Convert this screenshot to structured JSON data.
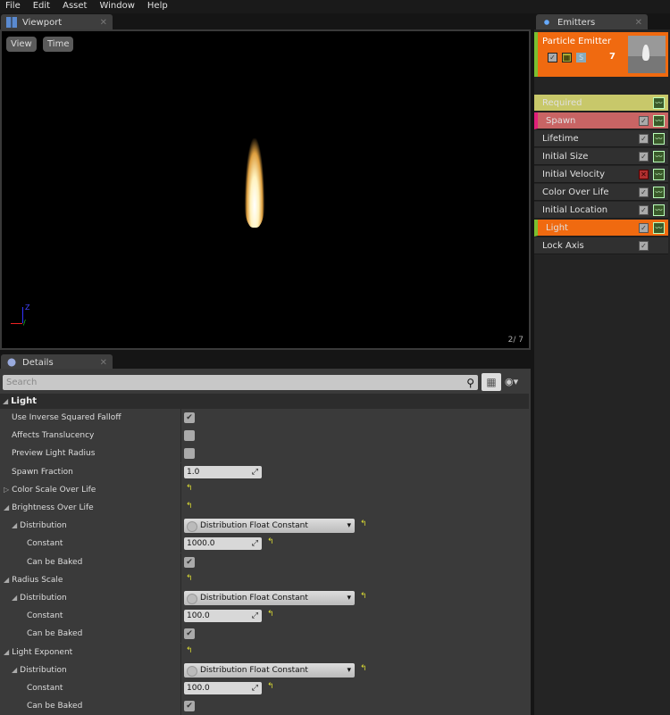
{
  "menu": [
    "File",
    "Edit",
    "Asset",
    "Window",
    "Help"
  ],
  "viewport": {
    "tab": "Viewport",
    "view_btn": "View",
    "time_btn": "Time",
    "counter": "2/  7",
    "axis_z": "Z"
  },
  "emitters": {
    "tab": "Emitters",
    "emitter_name": "Particle Emitter",
    "s_label": "S",
    "count": "7",
    "modules": [
      {
        "label": "Required",
        "bg": "#c8c86a",
        "cb": "none",
        "curve": true
      },
      {
        "label": "Spawn",
        "bg": "#c86464",
        "cb": "check",
        "curve": true,
        "accent": "#e0207a"
      },
      {
        "label": "Lifetime",
        "bg": "#303030",
        "cb": "check",
        "curve": true
      },
      {
        "label": "Initial Size",
        "bg": "#303030",
        "cb": "check",
        "curve": true
      },
      {
        "label": "Initial Velocity",
        "bg": "#303030",
        "cb": "x",
        "curve": true
      },
      {
        "label": "Color Over Life",
        "bg": "#303030",
        "cb": "check",
        "curve": true
      },
      {
        "label": "Initial Location",
        "bg": "#303030",
        "cb": "check",
        "curve": true
      },
      {
        "label": "Light",
        "bg": "#f06a10",
        "cb": "check",
        "curve": true,
        "accent": "#7ac030"
      },
      {
        "label": "Lock Axis",
        "bg": "#303030",
        "cb": "check",
        "curve": false
      }
    ]
  },
  "details": {
    "tab": "Details",
    "search_placeholder": "Search",
    "category": "Light",
    "rows": [
      {
        "label": "Use Inverse Squared Falloff",
        "indent": 0,
        "type": "check",
        "checked": true
      },
      {
        "label": "Affects Translucency",
        "indent": 0,
        "type": "check",
        "checked": false
      },
      {
        "label": "Preview Light Radius",
        "indent": 0,
        "type": "check",
        "checked": false
      },
      {
        "label": "Spawn Fraction",
        "indent": 0,
        "type": "num",
        "value": "1.0"
      },
      {
        "label": "Color Scale Over Life",
        "indent": 0,
        "arrow": "▷",
        "type": "reset"
      },
      {
        "label": "Brightness Over Life",
        "indent": 0,
        "arrow": "◢",
        "type": "reset"
      },
      {
        "label": "Distribution",
        "indent": 1,
        "arrow": "◢",
        "type": "dd",
        "value": "Distribution Float Constant"
      },
      {
        "label": "Constant",
        "indent": 2,
        "type": "num",
        "value": "1000.0",
        "reset": true
      },
      {
        "label": "Can be Baked",
        "indent": 2,
        "type": "check",
        "checked": true
      },
      {
        "label": "Radius Scale",
        "indent": 0,
        "arrow": "◢",
        "type": "reset"
      },
      {
        "label": "Distribution",
        "indent": 1,
        "arrow": "◢",
        "type": "dd",
        "value": "Distribution Float Constant"
      },
      {
        "label": "Constant",
        "indent": 2,
        "type": "num",
        "value": "100.0",
        "reset": true
      },
      {
        "label": "Can be Baked",
        "indent": 2,
        "type": "check",
        "checked": true
      },
      {
        "label": "Light Exponent",
        "indent": 0,
        "arrow": "◢",
        "type": "reset"
      },
      {
        "label": "Distribution",
        "indent": 1,
        "arrow": "◢",
        "type": "dd",
        "value": "Distribution Float Constant"
      },
      {
        "label": "Constant",
        "indent": 2,
        "type": "num",
        "value": "100.0",
        "reset": true
      },
      {
        "label": "Can be Baked",
        "indent": 2,
        "type": "check",
        "checked": true
      }
    ]
  }
}
